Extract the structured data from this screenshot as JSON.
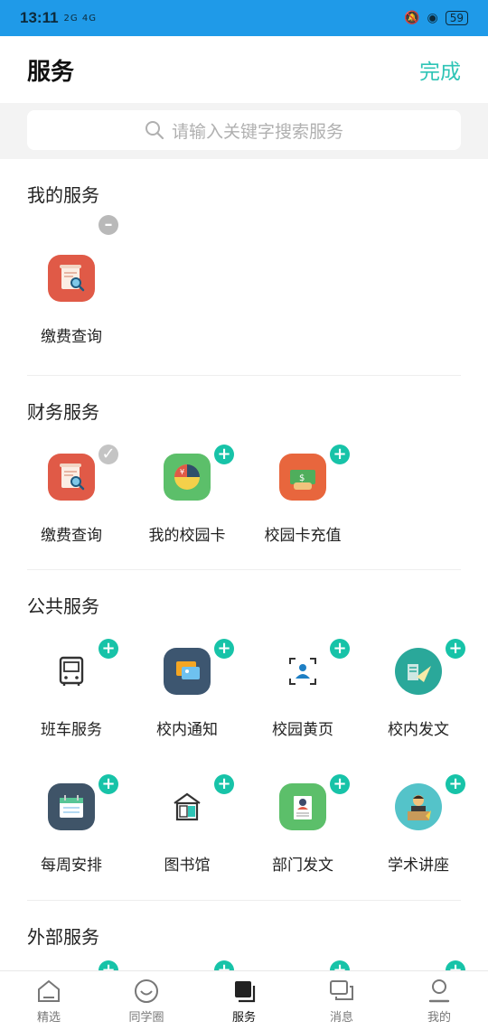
{
  "status_bar": {
    "time": "13:11",
    "network": "2G 4G",
    "battery": "59"
  },
  "header": {
    "title": "服务",
    "done_label": "完成"
  },
  "search": {
    "placeholder": "请输入关键字搜索服务"
  },
  "sections": {
    "my": {
      "title": "我的服务",
      "items": [
        {
          "label": "缴费查询",
          "icon": "fee-query-icon"
        }
      ]
    },
    "finance": {
      "title": "财务服务",
      "items": [
        {
          "label": "缴费查询",
          "icon": "fee-query-icon"
        },
        {
          "label": "我的校园卡",
          "icon": "campus-card-icon"
        },
        {
          "label": "校园卡充值",
          "icon": "card-recharge-icon"
        }
      ]
    },
    "public": {
      "title": "公共服务",
      "items": [
        {
          "label": "班车服务",
          "icon": "bus-icon"
        },
        {
          "label": "校内通知",
          "icon": "notice-icon"
        },
        {
          "label": "校园黄页",
          "icon": "contacts-icon"
        },
        {
          "label": "校内发文",
          "icon": "document-plane-icon"
        },
        {
          "label": "每周安排",
          "icon": "calendar-icon"
        },
        {
          "label": "图书馆",
          "icon": "library-icon"
        },
        {
          "label": "部门发文",
          "icon": "department-doc-icon"
        },
        {
          "label": "学术讲座",
          "icon": "lecture-icon"
        }
      ]
    },
    "external": {
      "title": "外部服务"
    }
  },
  "tabbar": [
    {
      "label": "精选",
      "icon": "home-icon"
    },
    {
      "label": "同学圈",
      "icon": "smile-icon"
    },
    {
      "label": "服务",
      "icon": "service-icon",
      "active": true
    },
    {
      "label": "消息",
      "icon": "message-icon"
    },
    {
      "label": "我的",
      "icon": "profile-icon"
    }
  ],
  "colors": {
    "accent": "#2ec4b6",
    "add_badge": "#17c3a8",
    "status_bar": "#1f9ae8"
  }
}
